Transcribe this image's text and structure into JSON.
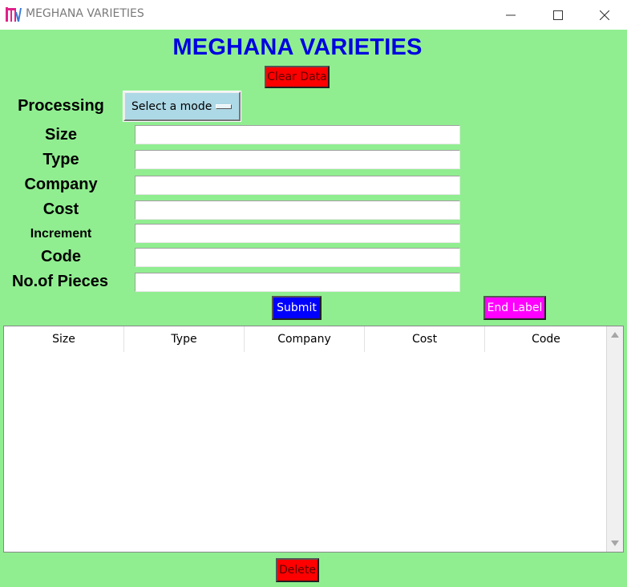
{
  "window": {
    "title": "MEGHANA VARIETIES",
    "app_icon": "tk-app-icon",
    "controls": [
      "minimize-icon",
      "maximize-icon",
      "close-icon"
    ]
  },
  "heading": "MEGHANA VARIETIES",
  "buttons": {
    "clear_data": "Clear Data",
    "submit": "Submit",
    "end_label": "End Label",
    "delete": "Delete"
  },
  "processing": {
    "label": "Processing",
    "selected": "Select a mode"
  },
  "fields": [
    {
      "label": "Size",
      "value": ""
    },
    {
      "label": "Type",
      "value": ""
    },
    {
      "label": "Company",
      "value": ""
    },
    {
      "label": "Cost",
      "value": ""
    },
    {
      "label": "Increment",
      "value": ""
    },
    {
      "label": "Code",
      "value": ""
    },
    {
      "label": "No.of Pieces",
      "value": ""
    }
  ],
  "table": {
    "columns": [
      "Size",
      "Type",
      "Company",
      "Cost",
      "Code"
    ],
    "rows": []
  },
  "colors": {
    "background": "#90ee90",
    "heading": "#0000e0",
    "clear_button": "#ff0000",
    "submit_button": "#0000ff",
    "end_label_button": "#ff00ff",
    "mode_menu": "#add8e6"
  }
}
